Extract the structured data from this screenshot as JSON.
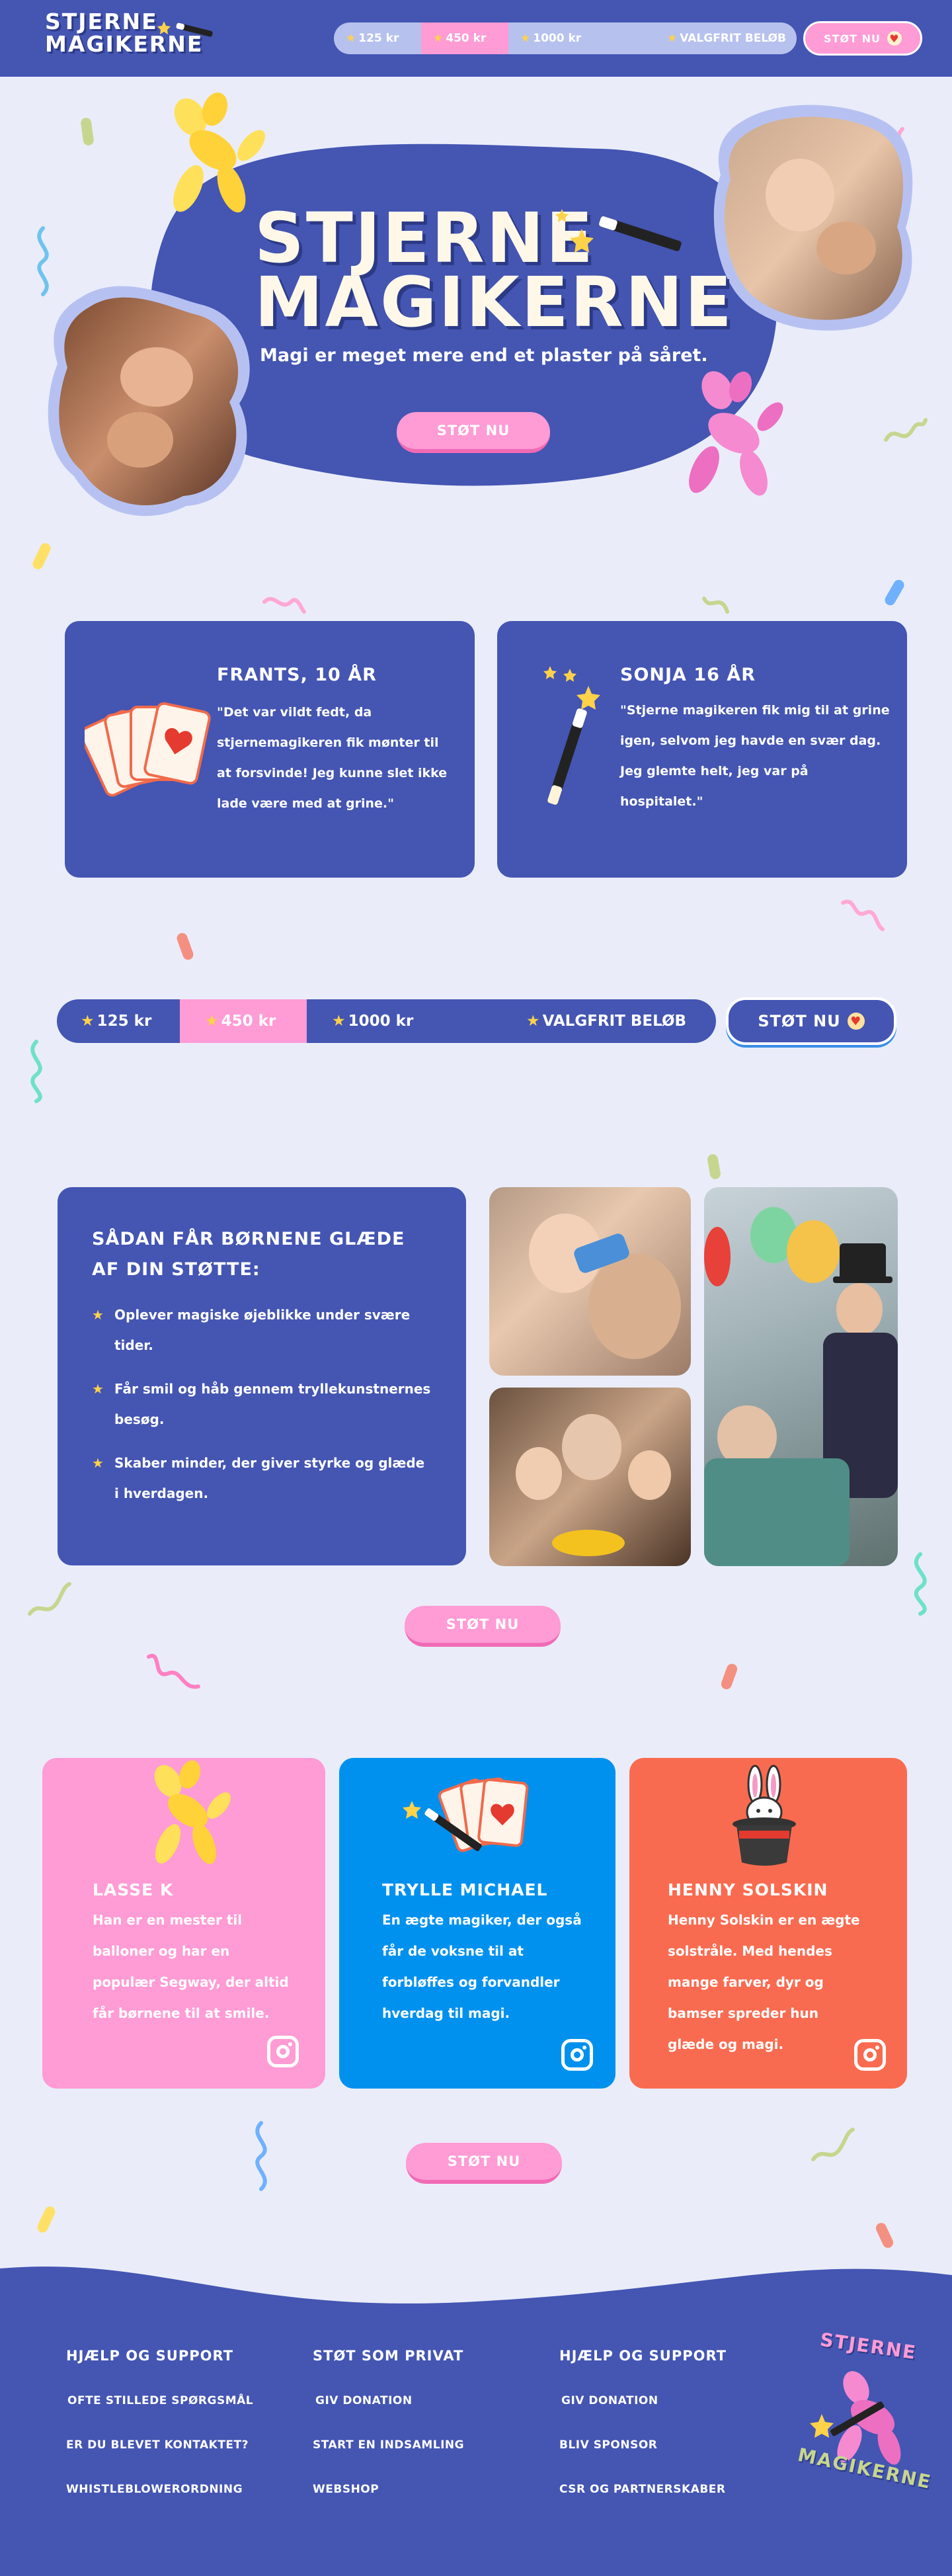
{
  "header": {
    "logo_line1": "STJERNE",
    "logo_line2": "MAGIKERNE",
    "nav_amounts": [
      "125 kr",
      "450 kr",
      "1000 kr",
      "VALGFRIT BELØB"
    ],
    "support_button": "STØT NU"
  },
  "hero": {
    "title_line1": "STJERNE",
    "title_line2": "MAGIKERNE",
    "subtitle": "Magi er meget mere end et plaster på såret.",
    "cta": "STØT NU"
  },
  "testimonials": [
    {
      "name": "FRANTS, 10 ÅR",
      "quote": "\"Det var vildt fedt, da stjernemagikeren fik mønter til at forsvinde! Jeg kunne slet ikke lade være med at grine.\""
    },
    {
      "name": "SONJA 16 ÅR",
      "quote": "\"Stjerne magikeren fik mig til at grine igen, selvom jeg havde en svær dag. Jeg glemte helt, jeg var på hospitalet.\""
    }
  ],
  "donate": {
    "amounts": [
      "125 kr",
      "450 kr",
      "1000 kr",
      "VALGFRIT BELØB"
    ],
    "button": "STØT NU"
  },
  "benefits": {
    "title": "SÅDAN FÅR BØRNENE GLÆDE AF DIN STØTTE:",
    "items": [
      "Oplever magiske øjeblikke under svære tider.",
      "Får smil og håb gennem tryllekunstnernes besøg.",
      "Skaber minder, der giver styrke og glæde i hverdagen."
    ],
    "cta": "STØT NU"
  },
  "magicians": [
    {
      "name": "LASSE K",
      "desc": "Han er en mester til balloner og har en populær Segway, der altid får børnene til at smile."
    },
    {
      "name": "TRYLLE MICHAEL",
      "desc": "En ægte magiker, der også får de voksne til at forbløffes og forvandler hverdag til magi."
    },
    {
      "name": "HENNY SOLSKIN",
      "desc": "Henny Solskin er en ægte solstråle. Med hendes mange farver, dyr og bamser spreder hun glæde og magi."
    }
  ],
  "magicians_cta": "STØT NU",
  "footer": {
    "columns": [
      {
        "heading": "HJÆLP OG SUPPORT",
        "links": [
          "OFTE STILLEDE SPØRGSMÅL",
          "ER DU BLEVET KONTAKTET?",
          "WHISTLEBLOWERORDNING"
        ]
      },
      {
        "heading": "STØT SOM PRIVAT",
        "links": [
          "GIV DONATION",
          "START EN INDSAMLING",
          "WEBSHOP"
        ]
      },
      {
        "heading": "HJÆLP OG SUPPORT",
        "links": [
          "GIV DONATION",
          "BLIV SPONSOR",
          "CSR OG PARTNERSKABER"
        ]
      }
    ],
    "logo_line1": "STJERNE",
    "logo_line2": "MAGIKERNE"
  },
  "colors": {
    "background": "#eaedf9",
    "brand_blue": "#4455b2",
    "pink": "#ff9bd5",
    "bright_blue": "#0091ee",
    "coral": "#f96b50",
    "star_yellow": "#ffd24a"
  },
  "icons": [
    "star-icon",
    "magic-wand-icon",
    "balloon-dog-icon",
    "playing-cards-icon",
    "heart-icon",
    "rabbit-hat-icon",
    "instagram-icon"
  ]
}
